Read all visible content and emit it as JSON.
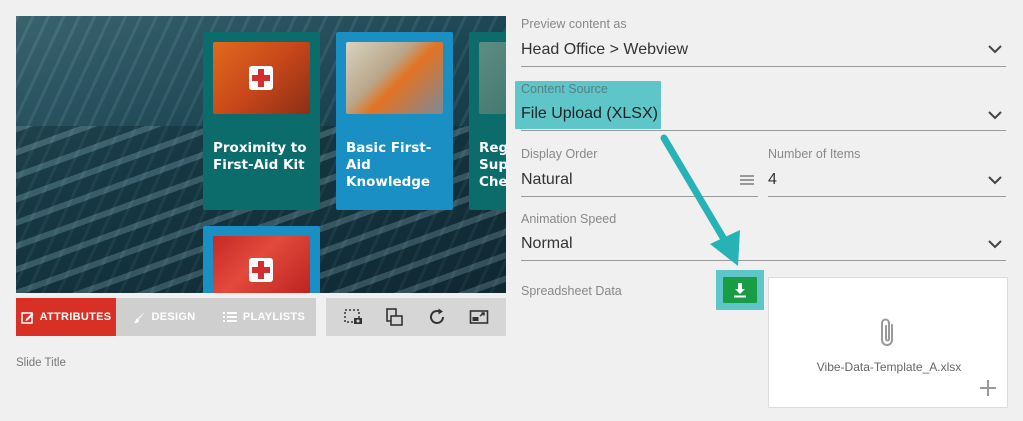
{
  "preview": {
    "cards": [
      {
        "title_line1": "Proximity to",
        "title_line2": "First-Aid Kit",
        "title_line3": ""
      },
      {
        "title_line1": "Basic First-",
        "title_line2": "Aid",
        "title_line3": "Knowledge"
      },
      {
        "title_line1": "Reg",
        "title_line2": "Sup",
        "title_line3": "Che"
      }
    ]
  },
  "tabs": {
    "attributes": "ATTRIBUTES",
    "design": "DESIGN",
    "playlists": "PLAYLISTS"
  },
  "slide_title_label": "Slide Title",
  "form": {
    "preview_as": {
      "label": "Preview content as",
      "value": "Head Office > Webview"
    },
    "content_source": {
      "label": "Content Source",
      "value": "File Upload (XLSX)"
    },
    "display_order": {
      "label": "Display Order",
      "value": "Natural"
    },
    "number_of_items": {
      "label": "Number of Items",
      "value": "4"
    },
    "animation_speed": {
      "label": "Animation Speed",
      "value": "Normal"
    },
    "spreadsheet_data": {
      "label": "Spreadsheet Data",
      "file_name": "Vibe-Data-Template_A.xlsx"
    }
  },
  "colors": {
    "accent_red": "#d93025",
    "highlight_teal": "#5ec5c8",
    "download_green": "#1a9c45",
    "card_teal": "#0c6b6b",
    "card_blue": "#1a8fc4"
  }
}
